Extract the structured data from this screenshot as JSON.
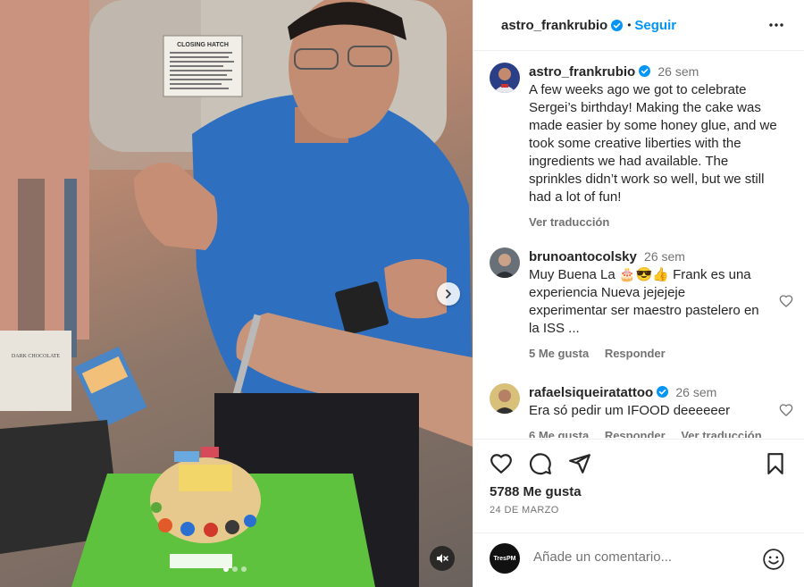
{
  "header": {
    "username": "astro_frankrubio",
    "separator": "•",
    "follow_label": "Seguir"
  },
  "media": {
    "hatch_sign_title": "CLOSING HATCH",
    "slide_count": 3,
    "active_slide": 1
  },
  "caption": {
    "username": "astro_frankrubio",
    "time": "26 sem",
    "text": "A few weeks ago we got to celebrate Sergei’s birthday! Making the cake was made easier by some honey glue, and we took some creative liberties with the ingredients we had available. The sprinkles didn’t work so well, but we still had a lot of fun!",
    "translate_label": "Ver traducción"
  },
  "comments": [
    {
      "username": "brunoantocolsky",
      "time": "26 sem",
      "text": "Muy Buena La 🎂😎👍 Frank es una experiencia Nueva jejejeje experimentar ser maestro pastelero en la ISS ...",
      "likes": "5 Me gusta",
      "reply_label": "Responder"
    },
    {
      "username": "rafaelsiqueiratattoo",
      "time": "26 sem",
      "text": "Era só pedir um IFOOD deeeeeer",
      "likes": "6 Me gusta",
      "reply_label": "Responder",
      "translate_label": "Ver traducción"
    }
  ],
  "actions": {
    "likes_text": "5788 Me gusta",
    "date": "24 DE MARZO"
  },
  "add_comment": {
    "avatar_text": "TresPM",
    "placeholder": "Añade un comentario..."
  },
  "colors": {
    "accent": "#0095f6",
    "text": "#262626",
    "secondary": "#737373",
    "divider": "#efefef"
  }
}
